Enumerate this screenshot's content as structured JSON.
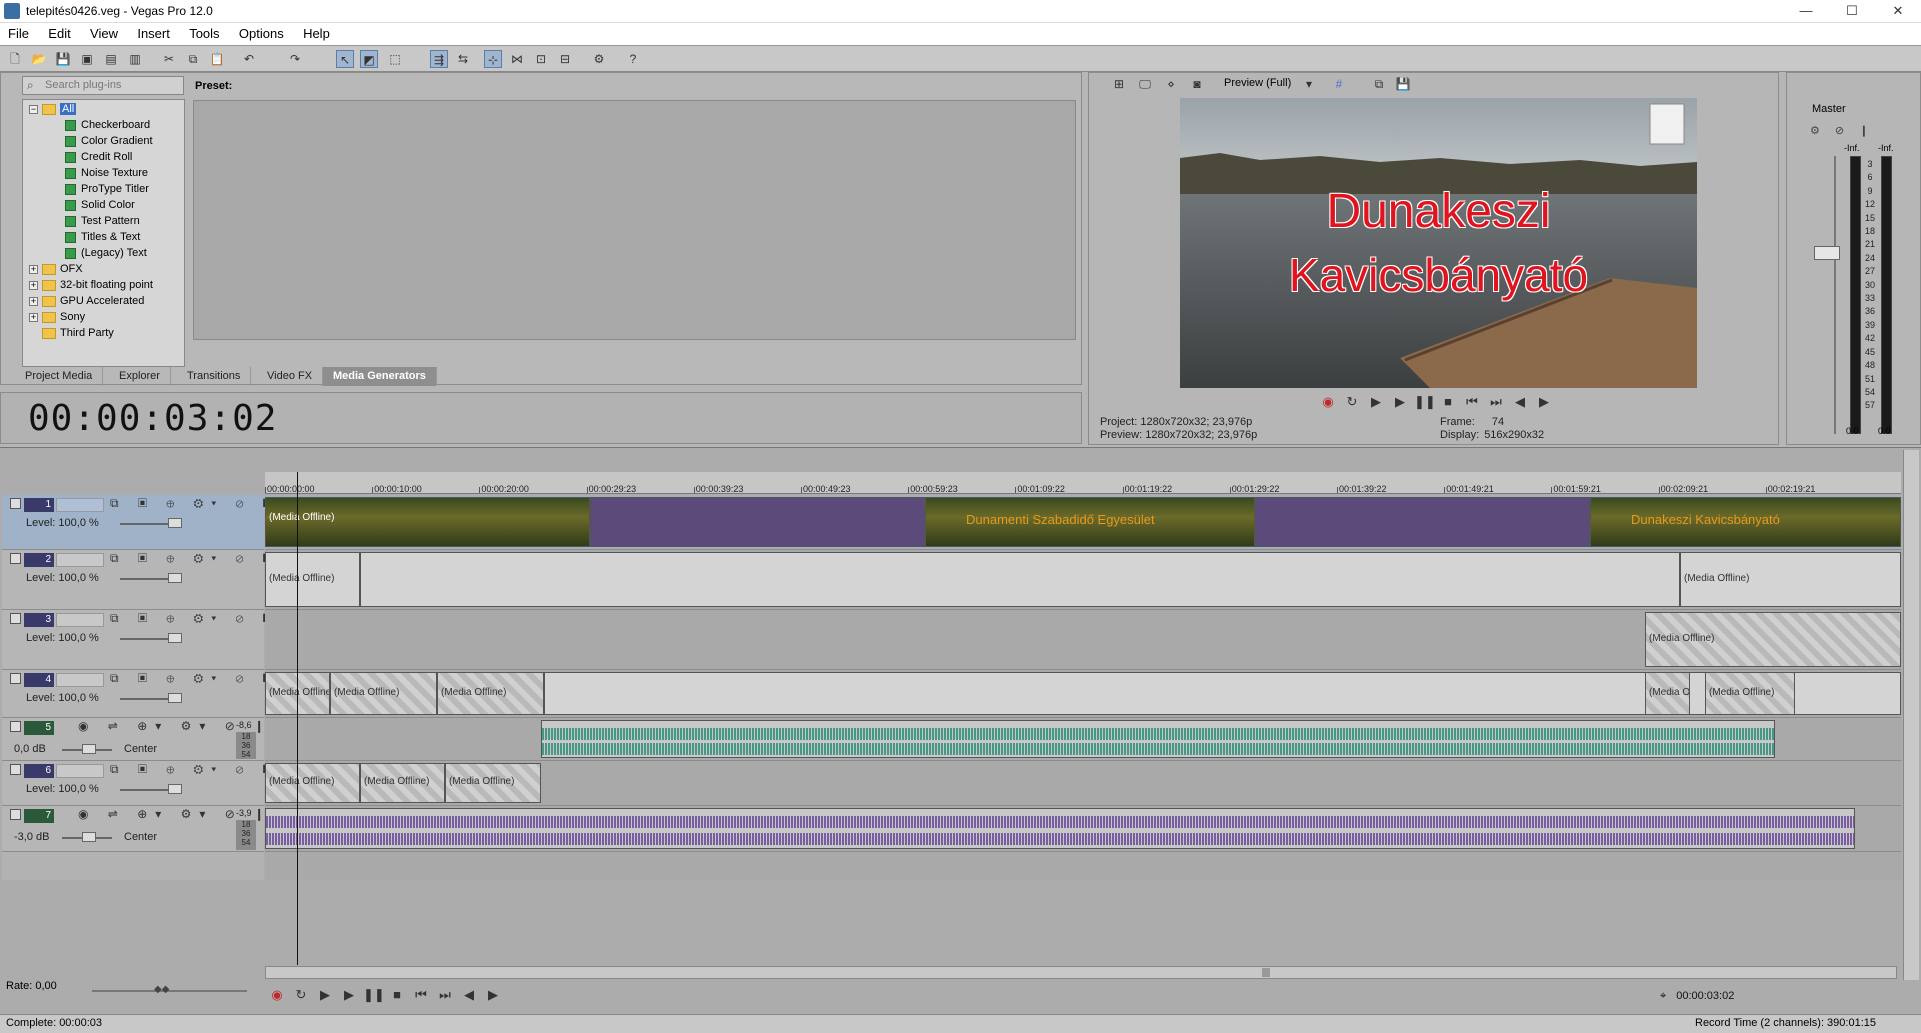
{
  "window": {
    "title": "telepités0426.veg - Vegas Pro 12.0",
    "min": "—",
    "max": "☐",
    "close": "✕"
  },
  "menu": [
    "File",
    "Edit",
    "View",
    "Insert",
    "Tools",
    "Options",
    "Help"
  ],
  "plugins": {
    "search_placeholder": "Search plug-ins",
    "preset_label": "Preset:",
    "tree_root": "All",
    "generators": [
      "Checkerboard",
      "Color Gradient",
      "Credit Roll",
      "Noise Texture",
      "ProType Titler",
      "Solid Color",
      "Test Pattern",
      "Titles & Text",
      "(Legacy) Text"
    ],
    "folders": [
      "OFX",
      "32-bit floating point",
      "GPU Accelerated",
      "Sony",
      "Third Party"
    ]
  },
  "tabs": [
    "Project Media",
    "Explorer",
    "Transitions",
    "Video FX",
    "Media Generators"
  ],
  "active_tab": "Media Generators",
  "timecode": "00:00:03:02",
  "preview": {
    "mode": "Preview (Full)",
    "overlay_line1": "Dunakeszi",
    "overlay_line2": "Kavicsbányató",
    "project_label": "Project:",
    "project_value": "1280x720x32; 23,976p",
    "preview_label": "Preview:",
    "preview_value": "1280x720x32; 23,976p",
    "frame_label": "Frame:",
    "frame_value": "74",
    "display_label": "Display:",
    "display_value": "516x290x32"
  },
  "master": {
    "label": "Master",
    "left_peak": "-Inf.",
    "right_peak": "-Inf.",
    "left_bottom": "0.0",
    "right_bottom": "0.0",
    "scale": [
      "3",
      "6",
      "9",
      "12",
      "15",
      "18",
      "21",
      "24",
      "27",
      "30",
      "33",
      "36",
      "39",
      "42",
      "45",
      "48",
      "51",
      "54",
      "57"
    ]
  },
  "ruler": [
    "00:00:00:00",
    "00:00:10:00",
    "00:00:20:00",
    "00:00:29:23",
    "00:00:39:23",
    "00:00:49:23",
    "00:00:59:23",
    "00:01:09:22",
    "00:01:19:22",
    "00:01:29:22",
    "00:01:39:22",
    "00:01:49:21",
    "00:01:59:21",
    "00:02:09:21",
    "00:02:19:21"
  ],
  "tracks": [
    {
      "num": "1",
      "type": "video",
      "level": "Level: 100,0 %"
    },
    {
      "num": "2",
      "type": "video",
      "level": "Level: 100,0 %"
    },
    {
      "num": "3",
      "type": "video",
      "level": "Level: 100,0 %"
    },
    {
      "num": "4",
      "type": "video",
      "level": "Level: 100,0 %"
    },
    {
      "num": "5",
      "type": "audio",
      "level": "0,0 dB",
      "pan": "Center",
      "peak": "-8,6",
      "meter": [
        "18",
        "36",
        "54"
      ]
    },
    {
      "num": "6",
      "type": "video",
      "level": "Level: 100,0 %"
    },
    {
      "num": "7",
      "type": "audio",
      "level": "-3,0 dB",
      "pan": "Center",
      "peak": "-3,9",
      "meter": [
        "18",
        "36",
        "54"
      ]
    }
  ],
  "clips": {
    "offline": "(Media Offline)",
    "title_text": "Dunamenti Szabadidő Egyesület",
    "title_text_right": "Dunakeszi Kavicsbányató"
  },
  "rate": "Rate: 0,00",
  "cursor_tc": "00:00:03:02",
  "status": {
    "complete": "Complete: 00:00:03",
    "record": "Record Time (2 channels): 390:01:15"
  }
}
